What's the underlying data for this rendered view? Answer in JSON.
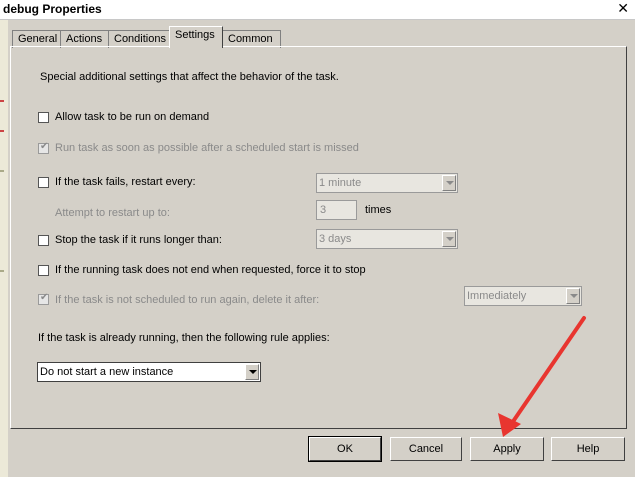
{
  "window": {
    "title": "debug Properties",
    "close_glyph": "✕"
  },
  "tabs": [
    {
      "label": "General",
      "active": false
    },
    {
      "label": "Actions",
      "active": false
    },
    {
      "label": "Conditions",
      "active": false
    },
    {
      "label": "Settings",
      "active": true
    },
    {
      "label": "Common",
      "active": false
    }
  ],
  "settings": {
    "description": "Special additional settings that affect the behavior of the task.",
    "allow_on_demand": {
      "label": "Allow task to be run on demand",
      "checked": false,
      "enabled": true
    },
    "run_asap": {
      "label": "Run task as soon as possible after a scheduled start is missed",
      "checked": true,
      "enabled": false
    },
    "restart_on_fail": {
      "label": "If the task fails, restart every:",
      "checked": false,
      "enabled": true,
      "interval": "1 minute"
    },
    "restart_attempts": {
      "label": "Attempt to restart up to:",
      "value": "3",
      "suffix": "times"
    },
    "stop_if_longer": {
      "label": "Stop the task if it runs longer than:",
      "checked": false,
      "enabled": true,
      "duration": "3 days"
    },
    "force_stop": {
      "label": "If the running task does not end when requested, force it to stop",
      "checked": false,
      "enabled": true
    },
    "delete_after": {
      "label": "If the task is not scheduled to run again, delete it after:",
      "checked": true,
      "enabled": false,
      "value": "Immediately"
    },
    "rule_label": "If the task is already running, then the following rule applies:",
    "rule_value": "Do not start a new instance"
  },
  "buttons": {
    "ok": "OK",
    "cancel": "Cancel",
    "apply": "Apply",
    "help": "Help"
  },
  "annotation": {
    "color": "#e8352f"
  }
}
